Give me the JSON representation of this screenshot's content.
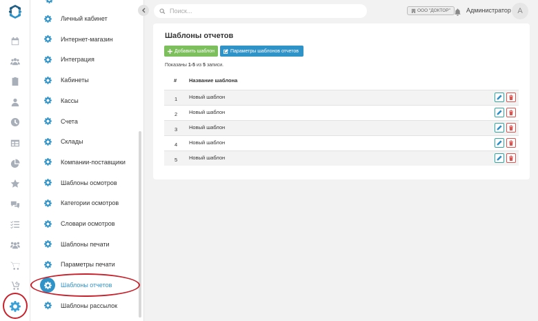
{
  "search": {
    "placeholder": "Поиск..."
  },
  "header": {
    "organization": "ООО \"ДОКТОР\"",
    "user_name": "Администратор",
    "avatar_initial": "А"
  },
  "rail": {
    "icons": [
      "logo-icon",
      "calendar-icon",
      "users-icon",
      "clipboard-icon",
      "user-icon",
      "clock-icon",
      "table-icon",
      "pie-chart-icon",
      "star-icon",
      "chat-icon",
      "checklist-icon",
      "group-icon",
      "cart-icon",
      "cart-plus-icon",
      "gear-icon"
    ],
    "active": "gear-icon"
  },
  "settings_menu": {
    "items": [
      {
        "label": "Личный кабинет"
      },
      {
        "label": "Интернет-магазин"
      },
      {
        "label": "Интеграция"
      },
      {
        "label": "Кабинеты"
      },
      {
        "label": "Кассы"
      },
      {
        "label": "Счета"
      },
      {
        "label": "Склады"
      },
      {
        "label": "Компании-поставщики"
      },
      {
        "label": "Шаблоны осмотров"
      },
      {
        "label": "Категории осмотров"
      },
      {
        "label": "Словари осмотров"
      },
      {
        "label": "Шаблоны печати"
      },
      {
        "label": "Параметры печати"
      },
      {
        "label": "Шаблоны отчетов"
      },
      {
        "label": "Шаблоны рассылок"
      }
    ],
    "active_index": 13
  },
  "main": {
    "title": "Шаблоны отчетов",
    "add_button": "Добавить шаблон",
    "params_button": "Параметры шаблонов отчетов",
    "shown": {
      "prefix": "Показаны",
      "range": "1-5",
      "middle": "из",
      "total": "5",
      "suffix": "записи."
    },
    "table": {
      "columns": [
        "#",
        "Название шаблона"
      ],
      "rows": [
        {
          "num": "1",
          "name": "Новый шаблон"
        },
        {
          "num": "2",
          "name": "Новый шаблон"
        },
        {
          "num": "3",
          "name": "Новый шаблон"
        },
        {
          "num": "4",
          "name": "Новый шаблон"
        },
        {
          "num": "5",
          "name": "Новый шаблон"
        }
      ]
    }
  },
  "colors": {
    "accent": "#2f93c8",
    "add_button": "#7cbf5c",
    "delete": "#d9534f",
    "annotation": "#c8202a"
  }
}
